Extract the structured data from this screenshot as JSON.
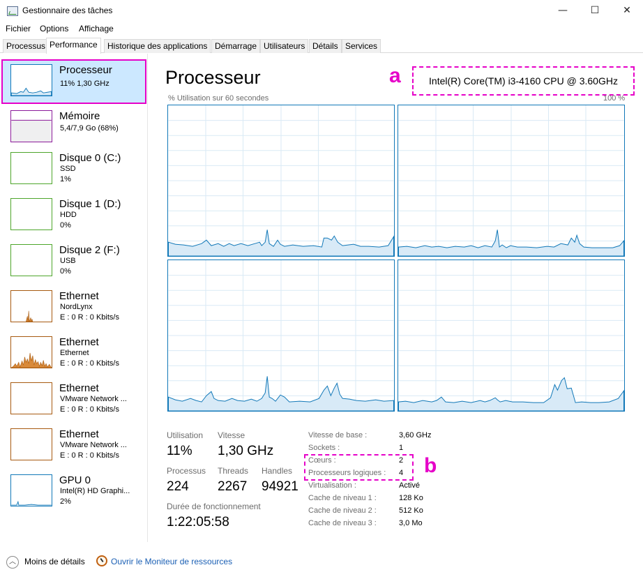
{
  "window": {
    "title": "Gestionnaire des tâches",
    "minimize_glyph": "—",
    "maximize_glyph": "☐",
    "close_glyph": "✕"
  },
  "menu": [
    "Fichier",
    "Options",
    "Affichage"
  ],
  "tabs": [
    "Processus",
    "Performance",
    "Historique des applications",
    "Démarrage",
    "Utilisateurs",
    "Détails",
    "Services"
  ],
  "active_tab": "Performance",
  "sidebar": {
    "items": [
      {
        "name": "Processeur",
        "sub1": "11%  1,30 GHz",
        "sub2": "",
        "color": "#1178b8",
        "kind": "cpu"
      },
      {
        "name": "Mémoire",
        "sub1": "5,4/7,9 Go (68%)",
        "sub2": "",
        "color": "#8b1a9a",
        "kind": "mem"
      },
      {
        "name": "Disque 0 (C:)",
        "sub1": "SSD",
        "sub2": "1%",
        "color": "#4da52a",
        "kind": "disk"
      },
      {
        "name": "Disque 1 (D:)",
        "sub1": "HDD",
        "sub2": "0%",
        "color": "#4da52a",
        "kind": "disk"
      },
      {
        "name": "Disque 2 (F:)",
        "sub1": "USB",
        "sub2": "0%",
        "color": "#4da52a",
        "kind": "disk"
      },
      {
        "name": "Ethernet",
        "sub1": "NordLynx",
        "sub2": "E : 0 R : 0 Kbits/s",
        "color": "#a75a10",
        "kind": "eth1"
      },
      {
        "name": "Ethernet",
        "sub1": "Ethernet",
        "sub2": "E : 0 R : 0 Kbits/s",
        "color": "#a75a10",
        "kind": "eth2"
      },
      {
        "name": "Ethernet",
        "sub1": "VMware Network ...",
        "sub2": "E : 0 R : 0 Kbits/s",
        "color": "#a75a10",
        "kind": "eth0"
      },
      {
        "name": "Ethernet",
        "sub1": "VMware Network ...",
        "sub2": "E : 0 R : 0 Kbits/s",
        "color": "#a75a10",
        "kind": "eth0"
      },
      {
        "name": "GPU 0",
        "sub1": "Intel(R) HD Graphi...",
        "sub2": "2%",
        "color": "#1178b8",
        "kind": "gpu"
      }
    ]
  },
  "main": {
    "title": "Processeur",
    "cpu_model": "Intel(R) Core(TM) i3-4160 CPU @ 3.60GHz",
    "graph_caption": "% Utilisation sur 60 secondes",
    "graph_max": "100 %",
    "callout_a": "a",
    "callout_b": "b",
    "accent_color": "#1178b8",
    "annotation_color": "#e600c8"
  },
  "stats": {
    "utilisation_label": "Utilisation",
    "utilisation_value": "11%",
    "vitesse_label": "Vitesse",
    "vitesse_value": "1,30 GHz",
    "processus_label": "Processus",
    "processus_value": "224",
    "threads_label": "Threads",
    "threads_value": "2267",
    "handles_label": "Handles",
    "handles_value": "94921",
    "uptime_label": "Durée de fonctionnement",
    "uptime_value": "1:22:05:58"
  },
  "specs": [
    {
      "label": "Vitesse de base :",
      "value": "3,60 GHz"
    },
    {
      "label": "Sockets :",
      "value": "1"
    },
    {
      "label": "Cœurs :",
      "value": "2"
    },
    {
      "label": "Processeurs logiques :",
      "value": "4"
    },
    {
      "label": "Virtualisation :",
      "value": "Activé"
    },
    {
      "label": "Cache de niveau 1 :",
      "value": "128 Ko"
    },
    {
      "label": "Cache de niveau 2 :",
      "value": "512 Ko"
    },
    {
      "label": "Cache de niveau 3 :",
      "value": "3,0 Mo"
    }
  ],
  "footer": {
    "less_details": "Moins de détails",
    "resource_monitor": "Ouvrir le Moniteur de ressources"
  }
}
